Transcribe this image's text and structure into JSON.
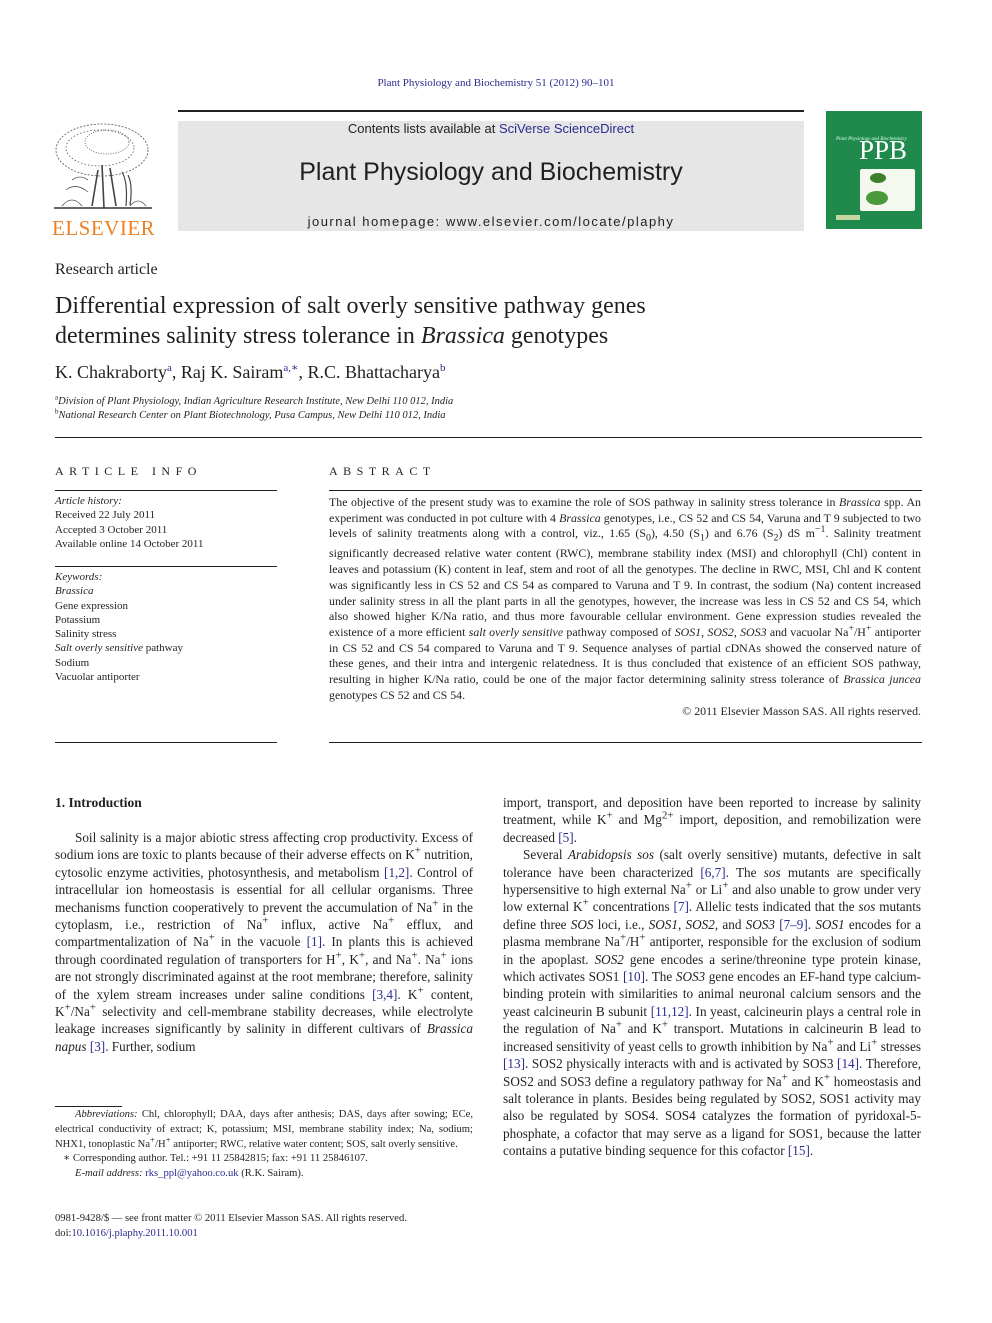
{
  "running_head": "Plant Physiology and Biochemistry 51 (2012) 90–101",
  "masthead": {
    "contents_prefix": "Contents lists available at ",
    "contents_link": "SciVerse ScienceDirect",
    "journal_title": "Plant Physiology and Biochemistry",
    "homepage": "journal homepage: www.elsevier.com/locate/plaphy",
    "publisher_logo_text": "ELSEVIER",
    "cover_abbrev": "PPB",
    "cover_small_title": "Plant Physiology and Biochemistry"
  },
  "colors": {
    "link": "#2b2b8f",
    "elsevier_orange": "#f07f22",
    "cover_green": "#1f8a4c",
    "masthead_bg": "#e6e6e6"
  },
  "article": {
    "type": "Research article",
    "title_line1": "Differential expression of salt overly sensitive pathway genes",
    "title_line2_prefix": "determines salinity stress tolerance in ",
    "title_line2_italic": "Brassica",
    "title_line2_suffix": " genotypes",
    "authors": [
      {
        "name": "K. Chakraborty",
        "sup": "a"
      },
      {
        "name": "Raj K. Sairam",
        "sup": "a,∗"
      },
      {
        "name": "R.C. Bhattacharya",
        "sup": "b"
      }
    ],
    "affiliations": [
      {
        "sup": "a",
        "text": "Division of Plant Physiology, Indian Agriculture Research Institute, New Delhi 110 012, India"
      },
      {
        "sup": "b",
        "text": "National Research Center on Plant Biotechnology, Pusa Campus, New Delhi 110 012, India"
      }
    ]
  },
  "article_info": {
    "heading": "ARTICLE INFO",
    "history_label": "Article history:",
    "history": [
      "Received 22 July 2011",
      "Accepted 3 October 2011",
      "Available online 14 October 2011"
    ],
    "keywords_label": "Keywords:",
    "keywords": [
      {
        "italic": "Brassica",
        "text": ""
      },
      {
        "italic": "",
        "text": "Gene expression"
      },
      {
        "italic": "",
        "text": "Potassium"
      },
      {
        "italic": "",
        "text": "Salinity stress"
      },
      {
        "italic": "Salt overly sensitive",
        "text": " pathway"
      },
      {
        "italic": "",
        "text": "Sodium"
      },
      {
        "italic": "",
        "text": "Vacuolar antiporter"
      }
    ]
  },
  "abstract": {
    "heading": "ABSTRACT",
    "html": "The objective of the present study was to examine the role of SOS pathway in salinity stress tolerance in <i>Brassica</i> spp. An experiment was conducted in pot culture with 4 <i>Brassica</i> genotypes, i.e., CS 52 and CS 54, Varuna and T 9 subjected to two levels of salinity treatments along with a control, viz., 1.65 (S<sub>0</sub>), 4.50 (S<sub>1</sub>) and 6.76 (S<sub>2</sub>) dS m<sup>−1</sup>. Salinity treatment significantly decreased relative water content (RWC), membrane stability index (MSI) and chlorophyll (Chl) content in leaves and potassium (K) content in leaf, stem and root of all the genotypes. The decline in RWC, MSI, Chl and K content was significantly less in CS 52 and CS 54 as compared to Varuna and T 9. In contrast, the sodium (Na) content increased under salinity stress in all the plant parts in all the genotypes, however, the increase was less in CS 52 and CS 54, which also showed higher K/Na ratio, and thus more favourable cellular environment. Gene expression studies revealed the existence of a more efficient <i>salt overly sensitive</i> pathway composed of <i>SOS1</i>, <i>SOS2</i>, <i>SOS3</i> and vacuolar Na<sup>+</sup>/H<sup>+</sup> antiporter in CS 52 and CS 54 compared to Varuna and T 9. Sequence analyses of partial cDNAs showed the conserved nature of these genes, and their intra and intergenic relatedness. It is thus concluded that existence of an efficient SOS pathway, resulting in higher K/Na ratio, could be one of the major factor determining salinity stress tolerance of <i>Brassica juncea</i> genotypes CS 52 and CS 54.",
    "copyright": "© 2011 Elsevier Masson SAS. All rights reserved."
  },
  "introduction": {
    "heading": "1.  Introduction",
    "left_html": "Soil salinity is a major abiotic stress affecting crop productivity. Excess of sodium ions are toxic to plants because of their adverse effects on K<sup>+</sup> nutrition, cytosolic enzyme activities, photosynthesis, and metabolism <span class=\"citation\">[1,2]</span>. Control of intracellular ion homeostasis is essential for all cellular organisms. Three mechanisms function cooperatively to prevent the accumulation of Na<sup>+</sup> in the cytoplasm, i.e., restriction of Na<sup>+</sup> influx, active Na<sup>+</sup> efflux, and compartmentalization of Na<sup>+</sup> in the vacuole <span class=\"citation\">[1]</span>. In plants this is achieved through coordinated regulation of transporters for H<sup>+</sup>, K<sup>+</sup>, and Na<sup>+</sup>. Na<sup>+</sup> ions are not strongly discriminated against at the root membrane; therefore, salinity of the xylem stream increases under saline conditions <span class=\"citation\">[3,4]</span>. K<sup>+</sup> content, K<sup>+</sup>/Na<sup>+</sup> selectivity and cell-membrane stability decreases, while electrolyte leakage increases significantly by salinity in different cultivars of <i>Brassica napus</i> <span class=\"citation\">[3]</span>. Further, sodium",
    "right_p1_html": "import, transport, and deposition have been reported to increase by salinity treatment, while K<sup>+</sup> and Mg<sup>2+</sup> import, deposition, and remobilization were decreased <span class=\"citation\">[5]</span>.",
    "right_p2_html": "Several <i>Arabidopsis sos</i> (salt overly sensitive) mutants, defective in salt tolerance have been characterized <span class=\"citation\">[6,7]</span>. The <i>sos</i> mutants are specifically hypersensitive to high external Na<sup>+</sup> or Li<sup>+</sup> and also unable to grow under very low external K<sup>+</sup> concentrations <span class=\"citation\">[7]</span>. Allelic tests indicated that the <i>sos</i> mutants define three <i>SOS</i> loci, i.e., <i>SOS1</i>, <i>SOS2</i>, and <i>SOS3</i> <span class=\"citation\">[7–9]</span>. <i>SOS1</i> encodes for a plasma membrane Na<sup>+</sup>/H<sup>+</sup> antiporter, responsible for the exclusion of sodium in the apoplast. <i>SOS2</i> gene encodes a serine/threonine type protein kinase, which activates SOS1 <span class=\"citation\">[10]</span>. The <i>SOS3</i> gene encodes an EF-hand type calcium-binding protein with similarities to animal neuronal calcium sensors and the yeast calcineurin B subunit <span class=\"citation\">[11,12]</span>. In yeast, calcineurin plays a central role in the regulation of Na<sup>+</sup> and K<sup>+</sup> transport. Mutations in calcineurin B lead to increased sensitivity of yeast cells to growth inhibition by Na<sup>+</sup> and Li<sup>+</sup> stresses <span class=\"citation\">[13]</span>. SOS2 physically interacts with and is activated by SOS3 <span class=\"citation\">[14]</span>. Therefore, SOS2 and SOS3 define a regulatory pathway for Na<sup>+</sup> and K<sup>+</sup> homeostasis and salt tolerance in plants. Besides being regulated by SOS2, SOS1 activity may also be regulated by SOS4. SOS4 catalyzes the formation of pyridoxal-5-phosphate, a cofactor that may serve as a ligand for SOS1, because the latter contains a putative binding sequence for this cofactor <span class=\"citation\">[15]</span>."
  },
  "footnotes": {
    "abbreviations_label": "Abbreviations:",
    "abbreviations_html": " Chl, chlorophyll; DAA, days after anthesis; DAS, days after sowing; ECe, electrical conductivity of extract; K, potassium; MSI, membrane stability index; Na, sodium; NHX1, tonoplastic Na<sup>+</sup>/H<sup>+</sup> antiporter; RWC, relative water content; SOS, salt overly sensitive.",
    "corresponding": "∗  Corresponding author. Tel.: +91 11 25842815; fax: +91 11 25846107.",
    "email_label": "E-mail address:",
    "email": "rks_ppl@yahoo.co.uk",
    "email_suffix": " (R.K. Sairam).",
    "front_matter": "0981-9428/$ — see front matter © 2011 Elsevier Masson SAS. All rights reserved.",
    "doi_label": "doi:",
    "doi": "10.1016/j.plaphy.2011.10.001"
  }
}
